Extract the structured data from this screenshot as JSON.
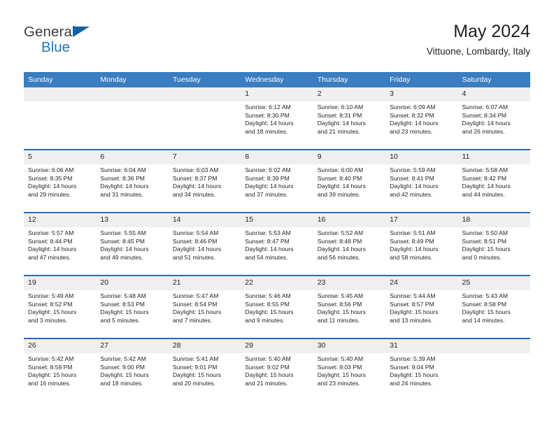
{
  "brand": {
    "line1": "General",
    "line2": "Blue",
    "triangle_color": "#1262a8",
    "blue_color": "#2175bb"
  },
  "header": {
    "title": "May 2024",
    "subtitle": "Vittuone, Lombardy, Italy"
  },
  "theme": {
    "header_bg": "#3a7dc0",
    "row_divider": "#2a6bb0",
    "daynum_bg": "#efefef",
    "text": "#231f20"
  },
  "weekday_headers": [
    "Sunday",
    "Monday",
    "Tuesday",
    "Wednesday",
    "Thursday",
    "Friday",
    "Saturday"
  ],
  "labels": {
    "sunrise_prefix": "Sunrise:",
    "sunset_prefix": "Sunset:",
    "daylight_prefix": "Daylight:"
  },
  "weeks": [
    [
      {
        "day": "",
        "sunrise": "",
        "sunset": "",
        "daylight_line1": "",
        "daylight_line2": "",
        "empty": true
      },
      {
        "day": "",
        "sunrise": "",
        "sunset": "",
        "daylight_line1": "",
        "daylight_line2": "",
        "empty": true
      },
      {
        "day": "",
        "sunrise": "",
        "sunset": "",
        "daylight_line1": "",
        "daylight_line2": "",
        "empty": true
      },
      {
        "day": "1",
        "sunrise": "Sunrise: 6:12 AM",
        "sunset": "Sunset: 8:30 PM",
        "daylight_line1": "Daylight: 14 hours",
        "daylight_line2": "and 18 minutes.",
        "empty": false
      },
      {
        "day": "2",
        "sunrise": "Sunrise: 6:10 AM",
        "sunset": "Sunset: 8:31 PM",
        "daylight_line1": "Daylight: 14 hours",
        "daylight_line2": "and 21 minutes.",
        "empty": false
      },
      {
        "day": "3",
        "sunrise": "Sunrise: 6:09 AM",
        "sunset": "Sunset: 8:32 PM",
        "daylight_line1": "Daylight: 14 hours",
        "daylight_line2": "and 23 minutes.",
        "empty": false
      },
      {
        "day": "4",
        "sunrise": "Sunrise: 6:07 AM",
        "sunset": "Sunset: 8:34 PM",
        "daylight_line1": "Daylight: 14 hours",
        "daylight_line2": "and 26 minutes.",
        "empty": false
      }
    ],
    [
      {
        "day": "5",
        "sunrise": "Sunrise: 6:06 AM",
        "sunset": "Sunset: 8:35 PM",
        "daylight_line1": "Daylight: 14 hours",
        "daylight_line2": "and 29 minutes.",
        "empty": false
      },
      {
        "day": "6",
        "sunrise": "Sunrise: 6:04 AM",
        "sunset": "Sunset: 8:36 PM",
        "daylight_line1": "Daylight: 14 hours",
        "daylight_line2": "and 31 minutes.",
        "empty": false
      },
      {
        "day": "7",
        "sunrise": "Sunrise: 6:03 AM",
        "sunset": "Sunset: 8:37 PM",
        "daylight_line1": "Daylight: 14 hours",
        "daylight_line2": "and 34 minutes.",
        "empty": false
      },
      {
        "day": "8",
        "sunrise": "Sunrise: 6:02 AM",
        "sunset": "Sunset: 8:39 PM",
        "daylight_line1": "Daylight: 14 hours",
        "daylight_line2": "and 37 minutes.",
        "empty": false
      },
      {
        "day": "9",
        "sunrise": "Sunrise: 6:00 AM",
        "sunset": "Sunset: 8:40 PM",
        "daylight_line1": "Daylight: 14 hours",
        "daylight_line2": "and 39 minutes.",
        "empty": false
      },
      {
        "day": "10",
        "sunrise": "Sunrise: 5:59 AM",
        "sunset": "Sunset: 8:41 PM",
        "daylight_line1": "Daylight: 14 hours",
        "daylight_line2": "and 42 minutes.",
        "empty": false
      },
      {
        "day": "11",
        "sunrise": "Sunrise: 5:58 AM",
        "sunset": "Sunset: 8:42 PM",
        "daylight_line1": "Daylight: 14 hours",
        "daylight_line2": "and 44 minutes.",
        "empty": false
      }
    ],
    [
      {
        "day": "12",
        "sunrise": "Sunrise: 5:57 AM",
        "sunset": "Sunset: 8:44 PM",
        "daylight_line1": "Daylight: 14 hours",
        "daylight_line2": "and 47 minutes.",
        "empty": false
      },
      {
        "day": "13",
        "sunrise": "Sunrise: 5:55 AM",
        "sunset": "Sunset: 8:45 PM",
        "daylight_line1": "Daylight: 14 hours",
        "daylight_line2": "and 49 minutes.",
        "empty": false
      },
      {
        "day": "14",
        "sunrise": "Sunrise: 5:54 AM",
        "sunset": "Sunset: 8:46 PM",
        "daylight_line1": "Daylight: 14 hours",
        "daylight_line2": "and 51 minutes.",
        "empty": false
      },
      {
        "day": "15",
        "sunrise": "Sunrise: 5:53 AM",
        "sunset": "Sunset: 8:47 PM",
        "daylight_line1": "Daylight: 14 hours",
        "daylight_line2": "and 54 minutes.",
        "empty": false
      },
      {
        "day": "16",
        "sunrise": "Sunrise: 5:52 AM",
        "sunset": "Sunset: 8:48 PM",
        "daylight_line1": "Daylight: 14 hours",
        "daylight_line2": "and 56 minutes.",
        "empty": false
      },
      {
        "day": "17",
        "sunrise": "Sunrise: 5:51 AM",
        "sunset": "Sunset: 8:49 PM",
        "daylight_line1": "Daylight: 14 hours",
        "daylight_line2": "and 58 minutes.",
        "empty": false
      },
      {
        "day": "18",
        "sunrise": "Sunrise: 5:50 AM",
        "sunset": "Sunset: 8:51 PM",
        "daylight_line1": "Daylight: 15 hours",
        "daylight_line2": "and 0 minutes.",
        "empty": false
      }
    ],
    [
      {
        "day": "19",
        "sunrise": "Sunrise: 5:49 AM",
        "sunset": "Sunset: 8:52 PM",
        "daylight_line1": "Daylight: 15 hours",
        "daylight_line2": "and 3 minutes.",
        "empty": false
      },
      {
        "day": "20",
        "sunrise": "Sunrise: 5:48 AM",
        "sunset": "Sunset: 8:53 PM",
        "daylight_line1": "Daylight: 15 hours",
        "daylight_line2": "and 5 minutes.",
        "empty": false
      },
      {
        "day": "21",
        "sunrise": "Sunrise: 5:47 AM",
        "sunset": "Sunset: 8:54 PM",
        "daylight_line1": "Daylight: 15 hours",
        "daylight_line2": "and 7 minutes.",
        "empty": false
      },
      {
        "day": "22",
        "sunrise": "Sunrise: 5:46 AM",
        "sunset": "Sunset: 8:55 PM",
        "daylight_line1": "Daylight: 15 hours",
        "daylight_line2": "and 9 minutes.",
        "empty": false
      },
      {
        "day": "23",
        "sunrise": "Sunrise: 5:45 AM",
        "sunset": "Sunset: 8:56 PM",
        "daylight_line1": "Daylight: 15 hours",
        "daylight_line2": "and 11 minutes.",
        "empty": false
      },
      {
        "day": "24",
        "sunrise": "Sunrise: 5:44 AM",
        "sunset": "Sunset: 8:57 PM",
        "daylight_line1": "Daylight: 15 hours",
        "daylight_line2": "and 13 minutes.",
        "empty": false
      },
      {
        "day": "25",
        "sunrise": "Sunrise: 5:43 AM",
        "sunset": "Sunset: 8:58 PM",
        "daylight_line1": "Daylight: 15 hours",
        "daylight_line2": "and 14 minutes.",
        "empty": false
      }
    ],
    [
      {
        "day": "26",
        "sunrise": "Sunrise: 5:42 AM",
        "sunset": "Sunset: 8:59 PM",
        "daylight_line1": "Daylight: 15 hours",
        "daylight_line2": "and 16 minutes.",
        "empty": false
      },
      {
        "day": "27",
        "sunrise": "Sunrise: 5:42 AM",
        "sunset": "Sunset: 9:00 PM",
        "daylight_line1": "Daylight: 15 hours",
        "daylight_line2": "and 18 minutes.",
        "empty": false
      },
      {
        "day": "28",
        "sunrise": "Sunrise: 5:41 AM",
        "sunset": "Sunset: 9:01 PM",
        "daylight_line1": "Daylight: 15 hours",
        "daylight_line2": "and 20 minutes.",
        "empty": false
      },
      {
        "day": "29",
        "sunrise": "Sunrise: 5:40 AM",
        "sunset": "Sunset: 9:02 PM",
        "daylight_line1": "Daylight: 15 hours",
        "daylight_line2": "and 21 minutes.",
        "empty": false
      },
      {
        "day": "30",
        "sunrise": "Sunrise: 5:40 AM",
        "sunset": "Sunset: 9:03 PM",
        "daylight_line1": "Daylight: 15 hours",
        "daylight_line2": "and 23 minutes.",
        "empty": false
      },
      {
        "day": "31",
        "sunrise": "Sunrise: 5:39 AM",
        "sunset": "Sunset: 9:04 PM",
        "daylight_line1": "Daylight: 15 hours",
        "daylight_line2": "and 24 minutes.",
        "empty": false
      },
      {
        "day": "",
        "sunrise": "",
        "sunset": "",
        "daylight_line1": "",
        "daylight_line2": "",
        "empty": true
      }
    ]
  ]
}
